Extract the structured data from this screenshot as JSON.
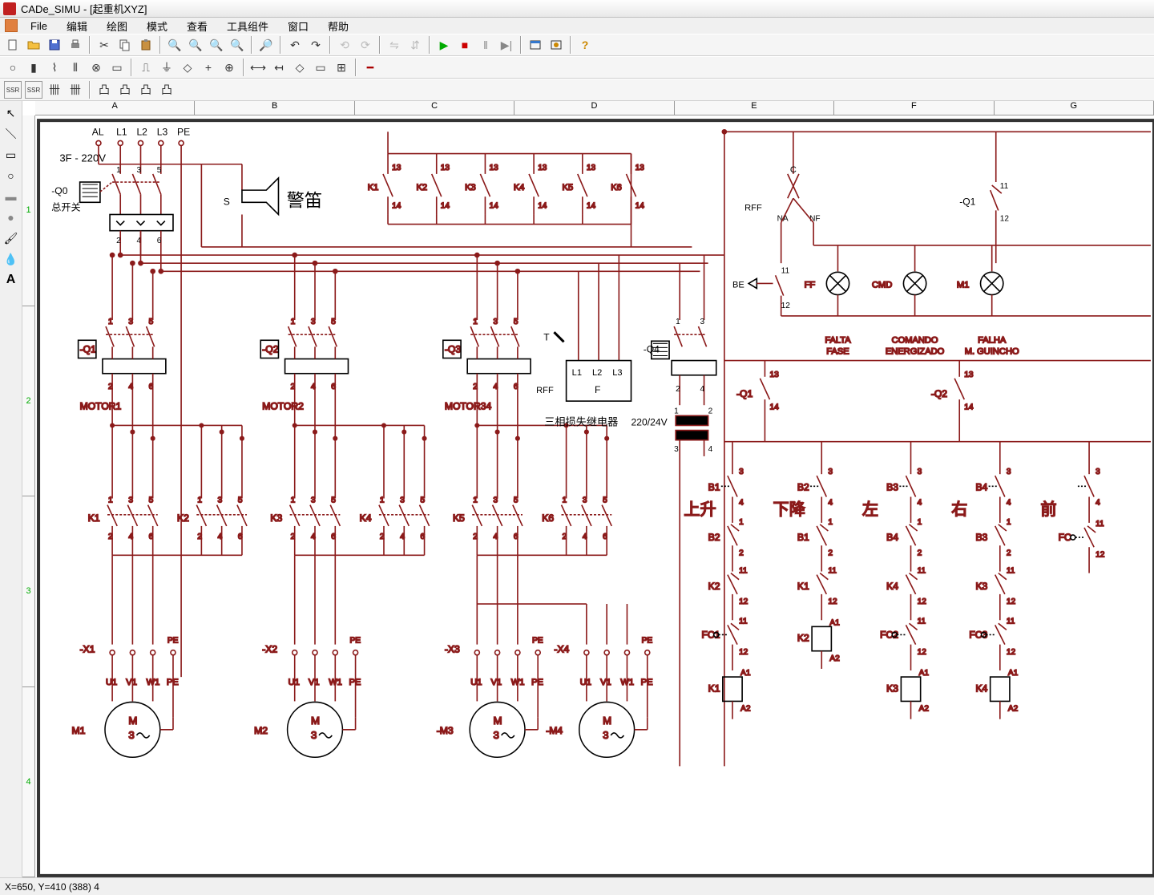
{
  "title": "CADe_SIMU - [起重机XYZ]",
  "menu": [
    "File",
    "编辑",
    "绘图",
    "模式",
    "查看",
    "工具组件",
    "窗口",
    "帮助"
  ],
  "ruler_cols": [
    "A",
    "B",
    "C",
    "D",
    "E",
    "F",
    "G"
  ],
  "ruler_rows": [
    "1",
    "2",
    "3",
    "4"
  ],
  "status": "X=650, Y=410 (388) 4",
  "schematic": {
    "supply": "3F - 220V",
    "supply_terms": [
      "AL",
      "L1",
      "L2",
      "L3",
      "PE"
    ],
    "main_switch": {
      "tag": "-Q0",
      "label": "总开关",
      "pins_top": [
        "1",
        "3",
        "5"
      ],
      "pins_bot": [
        "2",
        "4",
        "6"
      ]
    },
    "siren": {
      "tag": "S",
      "label": "警笛"
    },
    "alarm_contacts": [
      {
        "tag": "K1",
        "top": "13",
        "bot": "14"
      },
      {
        "tag": "K2",
        "top": "13",
        "bot": "14"
      },
      {
        "tag": "K3",
        "top": "13",
        "bot": "14"
      },
      {
        "tag": "K4",
        "top": "13",
        "bot": "14"
      },
      {
        "tag": "K5",
        "top": "13",
        "bot": "14"
      },
      {
        "tag": "K6",
        "top": "13",
        "bot": "14"
      }
    ],
    "motors_power": [
      {
        "q": "-Q1",
        "label": "MOTOR1",
        "kA": "K1",
        "kB": "K2"
      },
      {
        "q": "-Q2",
        "label": "MOTOR2",
        "kA": "K3",
        "kB": "K4"
      },
      {
        "q": "-Q3",
        "label": "MOTOR34",
        "kA": "K5",
        "kB": "K6"
      }
    ],
    "q4": {
      "tag": "-Q4",
      "pins_top": [
        "1",
        "3"
      ],
      "pins_bot": [
        "2",
        "4"
      ]
    },
    "phase_relay": {
      "tag": "F",
      "inputs": [
        "L1",
        "L2",
        "L3"
      ],
      "label": "三相损失继电器",
      "rff": "RFF",
      "t": "T"
    },
    "transformer": {
      "ratio": "220/24V",
      "pt": [
        "1",
        "2"
      ],
      "pb": [
        "3",
        "4"
      ]
    },
    "indicators": {
      "c": "C",
      "rff": "RFF",
      "na": "NA",
      "nf": "NF",
      "be": "BE",
      "lamps": [
        {
          "tag": "FF",
          "caption": "FALTA FASE"
        },
        {
          "tag": "CMD",
          "caption": "COMANDO ENERGIZADO"
        },
        {
          "tag": "M1",
          "caption": "FALHA M. GUINCHO"
        }
      ],
      "q1": {
        "tag": "-Q1",
        "top": "11",
        "bot": "12",
        "pins": [
          "11",
          "12"
        ]
      }
    },
    "q_aux": [
      {
        "tag": "-Q1",
        "top": "13",
        "bot": "14"
      },
      {
        "tag": "-Q2",
        "top": "13",
        "bot": "14"
      }
    ],
    "control_columns": [
      {
        "b": "B1",
        "dir": "上升",
        "chain": [
          "B2",
          "K2"
        ],
        "fc": "FC1",
        "coil": "K1"
      },
      {
        "b": "B2",
        "dir": "下降",
        "chain": [
          "B1",
          "K1"
        ],
        "fc": "",
        "coil": "K2"
      },
      {
        "b": "B3",
        "dir": "左",
        "chain": [
          "B4",
          "K4"
        ],
        "fc": "FC2",
        "coil": "K3"
      },
      {
        "b": "B4",
        "dir": "右",
        "chain": [
          "B3",
          "K3"
        ],
        "fc": "FC3",
        "coil": "K4"
      },
      {
        "b": "",
        "dir": "前",
        "chain": [],
        "fc": "FC",
        "coil": ""
      }
    ],
    "terminals": [
      {
        "x": "-X1",
        "m": "M1",
        "u": "U1",
        "v": "V1",
        "w": "W1",
        "pe": "PE"
      },
      {
        "x": "-X2",
        "m": "M2",
        "u": "U1",
        "v": "V1",
        "w": "W1",
        "pe": "PE"
      },
      {
        "x": "-X3",
        "m": "-M3",
        "u": "U1",
        "v": "V1",
        "w": "W1",
        "pe": "PE"
      },
      {
        "x": "-X4",
        "m": "-M4",
        "u": "U1",
        "v": "V1",
        "w": "W1",
        "pe": "PE"
      }
    ],
    "motor_text": {
      "M": "M",
      "three": "3"
    }
  }
}
